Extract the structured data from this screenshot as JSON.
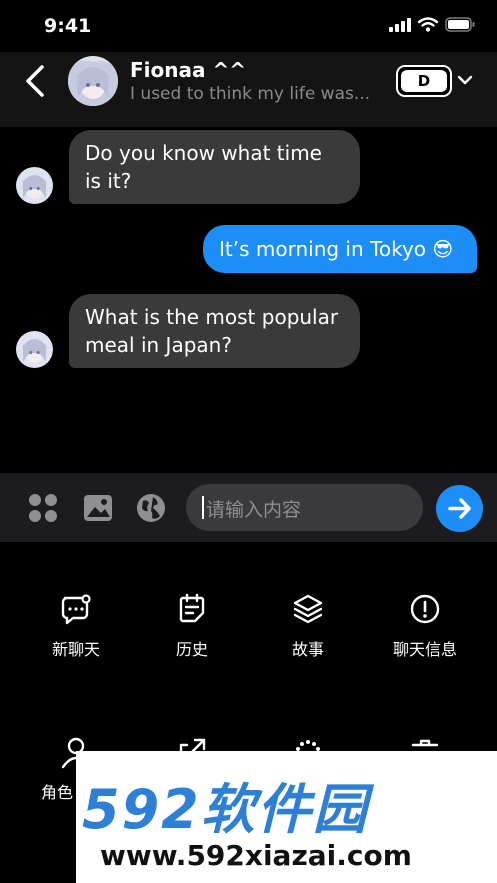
{
  "status_bar": {
    "time": "9:41"
  },
  "header": {
    "back_icon": "chevron-left-icon",
    "contact_name": "Fionaa ^^",
    "last_message": "I used to think my life was...",
    "model_label": "D",
    "dropdown_icon": "chevron-down-icon"
  },
  "messages": [
    {
      "direction": "incoming",
      "text": "Do you know what time is it?"
    },
    {
      "direction": "outgoing",
      "text": "It’s morning in Tokyo 😎"
    },
    {
      "direction": "incoming",
      "text": "What is the most popular meal in Japan?"
    }
  ],
  "input": {
    "placeholder": "请输入内容",
    "apps_icon": "grid-icon",
    "image_icon": "image-icon",
    "globe_icon": "globe-icon",
    "send_icon": "send-icon"
  },
  "tools": [
    {
      "label": "新聊天",
      "icon": "new-chat-icon"
    },
    {
      "label": "历史",
      "icon": "history-icon"
    },
    {
      "label": "故事",
      "icon": "layers-icon"
    },
    {
      "label": "聊天信息",
      "icon": "info-icon"
    },
    {
      "label": "角色",
      "icon": "user-icon"
    },
    {
      "label": "",
      "icon": "share-icon"
    },
    {
      "label": "",
      "icon": "dots-icon"
    },
    {
      "label": "",
      "icon": "trash-icon"
    }
  ],
  "watermark": {
    "brand": "592软件园",
    "url": "www.592xiazai.com"
  },
  "colors": {
    "accent": "#1d8ef5",
    "incoming_bubble": "#3a3a3a",
    "background": "#000000",
    "input_bar": "#1c1c1e"
  }
}
